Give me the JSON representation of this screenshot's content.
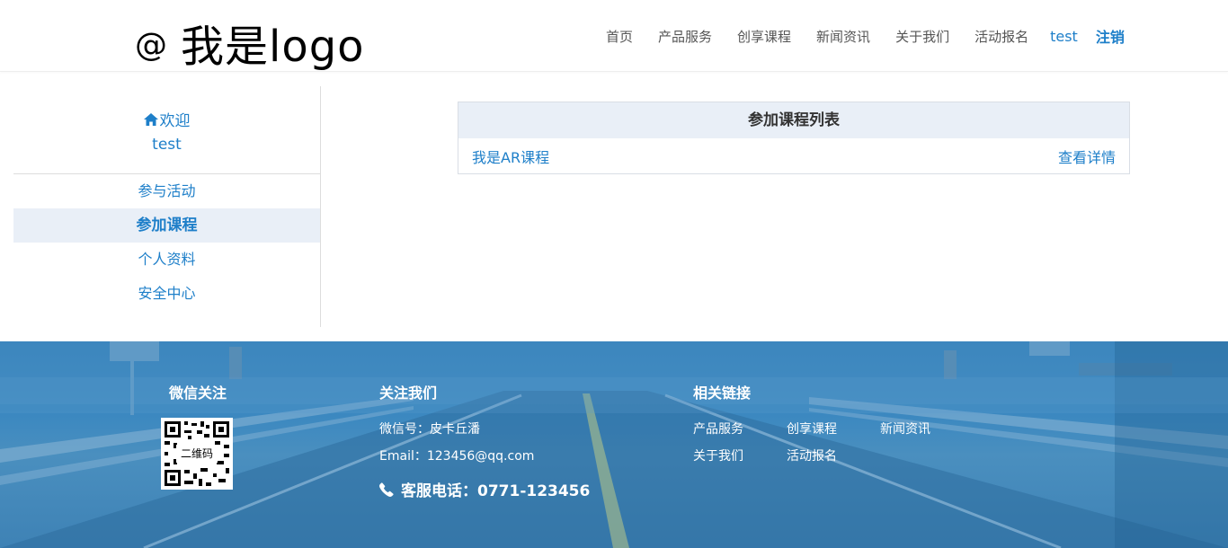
{
  "header": {
    "logo_at": "@",
    "logo_text": "我是logo",
    "nav": [
      "首页",
      "产品服务",
      "创享课程",
      "新闻资讯",
      "关于我们",
      "活动报名"
    ],
    "username": "test",
    "logout": "注销"
  },
  "sidebar": {
    "welcome": "欢迎",
    "username": "test",
    "items": [
      {
        "label": "参与活动",
        "active": false
      },
      {
        "label": "参加课程",
        "active": true
      },
      {
        "label": "个人资料",
        "active": false
      },
      {
        "label": "安全中心",
        "active": false
      }
    ]
  },
  "panel": {
    "title": "参加课程列表",
    "rows": [
      {
        "course": "我是AR课程",
        "action": "查看详情"
      }
    ]
  },
  "footer": {
    "wechat_title": "微信关注",
    "qr_label": "二维码",
    "follow_title": "关注我们",
    "wechat_id": "微信号：皮卡丘潘",
    "email": "Email：123456@qq.com",
    "phone": "客服电话：0771-123456",
    "links_title": "相关链接",
    "links": [
      "产品服务",
      "创享课程",
      "新闻资讯",
      "关于我们",
      "活动报名"
    ]
  },
  "colors": {
    "accent": "#1e7fc9",
    "active_bg": "#e9eff7",
    "footer_bg": "#3b88c0"
  }
}
